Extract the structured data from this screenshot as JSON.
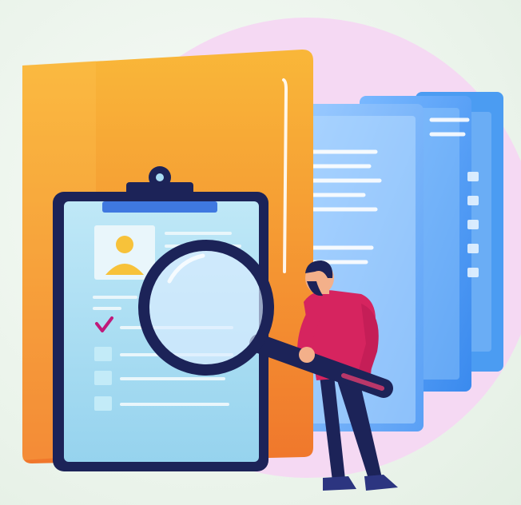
{
  "illustration": {
    "subject": "clipboard-with-candidate-profile-and-man-with-magnifying-glass",
    "icons": [
      "folder-icon",
      "documents-icon",
      "clipboard-icon",
      "profile-avatar-icon",
      "checkmark-icon",
      "magnifying-glass-icon",
      "person-icon"
    ],
    "colors": {
      "background": "#eaf3ea",
      "circle": "#f4d7f2",
      "folder_light": "#f8b436",
      "folder_dark": "#f07a2e",
      "docs_blue": "#3b8ff0",
      "docs_light": "#8fc7ff",
      "clipboard_frame": "#1c2358",
      "clipboard_paper": "#a9ddf4",
      "avatar_yellow": "#f7c23a",
      "check_magenta": "#c0187a",
      "shirt": "#d6245f",
      "pants": "#1c2358"
    },
    "checklist": [
      {
        "checked": true
      },
      {
        "checked": false
      },
      {
        "checked": false
      },
      {
        "checked": false
      }
    ]
  }
}
